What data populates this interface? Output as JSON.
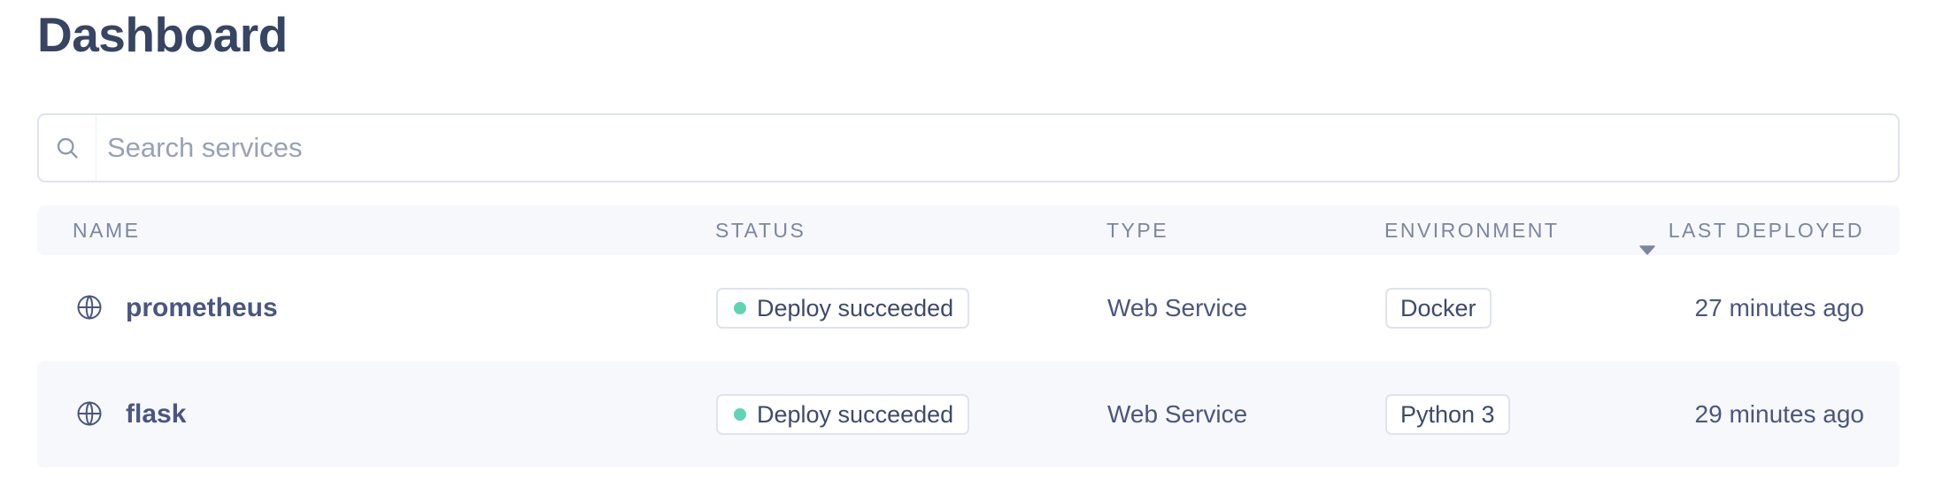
{
  "page_title": "Dashboard",
  "search": {
    "placeholder": "Search services",
    "value": ""
  },
  "table": {
    "columns": {
      "name": "NAME",
      "status": "STATUS",
      "type": "TYPE",
      "environment": "ENVIRONMENT",
      "last_deployed": "LAST DEPLOYED"
    },
    "sort": {
      "column": "last_deployed",
      "direction": "descending"
    },
    "rows": [
      {
        "name": "prometheus",
        "status": "Deploy succeeded",
        "type": "Web Service",
        "environment": "Docker",
        "last_deployed": "27 minutes ago"
      },
      {
        "name": "flask",
        "status": "Deploy succeeded",
        "type": "Web Service",
        "environment": "Python 3",
        "last_deployed": "29 minutes ago"
      }
    ]
  },
  "colors": {
    "title": "#374463",
    "status_success": "#5fd4b5",
    "header_bg": "#f7f8fb",
    "border": "#dfe3ee"
  },
  "icons": {
    "search": "search-icon",
    "row": "globe-icon",
    "sort": "caret-down-icon"
  }
}
